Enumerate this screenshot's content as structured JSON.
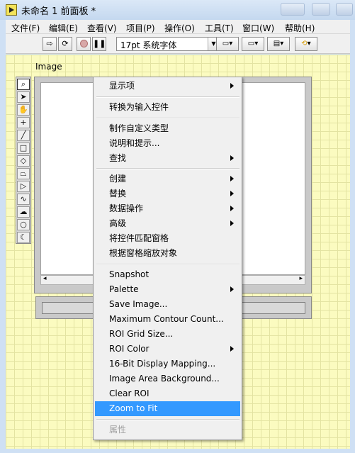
{
  "window": {
    "title": "未命名 1 前面板 *"
  },
  "menubar": {
    "items": [
      {
        "label": "文件(F)"
      },
      {
        "label": "编辑(E)"
      },
      {
        "label": "查看(V)"
      },
      {
        "label": "项目(P)"
      },
      {
        "label": "操作(O)"
      },
      {
        "label": "工具(T)"
      },
      {
        "label": "窗口(W)"
      },
      {
        "label": "帮助(H)"
      }
    ]
  },
  "toolbar": {
    "font_value": "17pt 系统字体",
    "icons": [
      "run-arrow-icon",
      "run-continuously-icon",
      "abort-icon",
      "pause-icon",
      "align-icon",
      "distribute-icon",
      "resize-icon",
      "reorder-icon"
    ]
  },
  "front_panel": {
    "control_label": "Image",
    "palette_icons": [
      "zoom-icon",
      "arrow-select-icon",
      "pan-hand-icon",
      "point-icon",
      "line-icon",
      "rectangle-icon",
      "rotated-rectangle-icon",
      "polygon-icon",
      "annulus-icon",
      "freehand-icon",
      "freehand-region-icon",
      "oval-icon",
      "broken-line-icon"
    ]
  },
  "context_menu": {
    "items": [
      {
        "label": "显示项",
        "submenu": true
      },
      {
        "label": "转换为输入控件",
        "submenu": false
      },
      {
        "label": "制作自定义类型",
        "submenu": false
      },
      {
        "label": "说明和提示...",
        "submenu": false
      },
      {
        "label": "查找",
        "submenu": true
      },
      {
        "label": "创建",
        "submenu": true
      },
      {
        "label": "替换",
        "submenu": true
      },
      {
        "label": "数据操作",
        "submenu": true
      },
      {
        "label": "高级",
        "submenu": true
      },
      {
        "label": "将控件匹配窗格",
        "submenu": false
      },
      {
        "label": "根据窗格缩放对象",
        "submenu": false
      },
      {
        "label": "Snapshot",
        "submenu": false
      },
      {
        "label": "Palette",
        "submenu": true
      },
      {
        "label": "Save Image...",
        "submenu": false
      },
      {
        "label": "Maximum Contour Count...",
        "submenu": false
      },
      {
        "label": "ROI Grid Size...",
        "submenu": false
      },
      {
        "label": "ROI Color",
        "submenu": true
      },
      {
        "label": "16-Bit Display Mapping...",
        "submenu": false
      },
      {
        "label": "Image Area Background...",
        "submenu": false
      },
      {
        "label": "Clear ROI",
        "submenu": false
      },
      {
        "label": "Zoom to Fit",
        "submenu": false,
        "highlighted": true
      },
      {
        "label": "属性",
        "submenu": false,
        "disabled": true
      }
    ],
    "highlight_color": "#3399ff"
  }
}
